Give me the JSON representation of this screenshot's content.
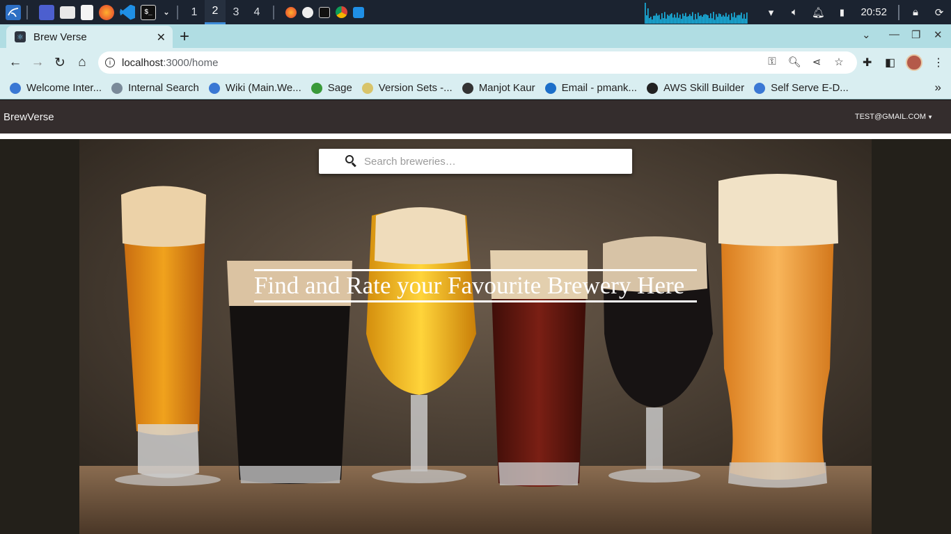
{
  "taskbar": {
    "workspaces": [
      "1",
      "2",
      "3",
      "4"
    ],
    "active_workspace": "2",
    "clock": "20:52",
    "apps": [
      "kali-menu-icon",
      "desktop-icon",
      "files-icon",
      "text-editor-icon",
      "firefox-icon",
      "vscode-icon",
      "terminal-icon"
    ]
  },
  "browser": {
    "tab_title": "Brew Verse",
    "url_host": "localhost",
    "url_path": ":3000/home",
    "bookmarks": [
      {
        "label": "Welcome Inter...",
        "icon": "wiki-icon",
        "color": "#3a78d4"
      },
      {
        "label": "Internal Search",
        "icon": "search-icon",
        "color": "#7a8a99"
      },
      {
        "label": "Wiki (Main.We...",
        "icon": "wiki-icon",
        "color": "#3a78d4"
      },
      {
        "label": "Sage",
        "icon": "leaf-icon",
        "color": "#3a9a3a"
      },
      {
        "label": "Version Sets -...",
        "icon": "version-sets-icon",
        "color": "#d8c46a"
      },
      {
        "label": "Manjot Kaur",
        "icon": "phone-icon",
        "color": "#333333"
      },
      {
        "label": "Email - pmank...",
        "icon": "outlook-icon",
        "color": "#1c6fc9"
      },
      {
        "label": "AWS Skill Builder",
        "icon": "aws-icon",
        "color": "#222222"
      },
      {
        "label": "Self Serve E-D...",
        "icon": "wiki-icon",
        "color": "#3a78d4"
      }
    ]
  },
  "app": {
    "brand": "BrewVerse",
    "user_email": "TEST@GMAIL.COM",
    "search_placeholder": "Search breweries…",
    "headline": "Find and Rate your Favourite Brewery Here"
  },
  "colors": {
    "appbar": "#342d2d",
    "tabstrip": "#b0dde3",
    "toolbar": "#d9eef1"
  }
}
